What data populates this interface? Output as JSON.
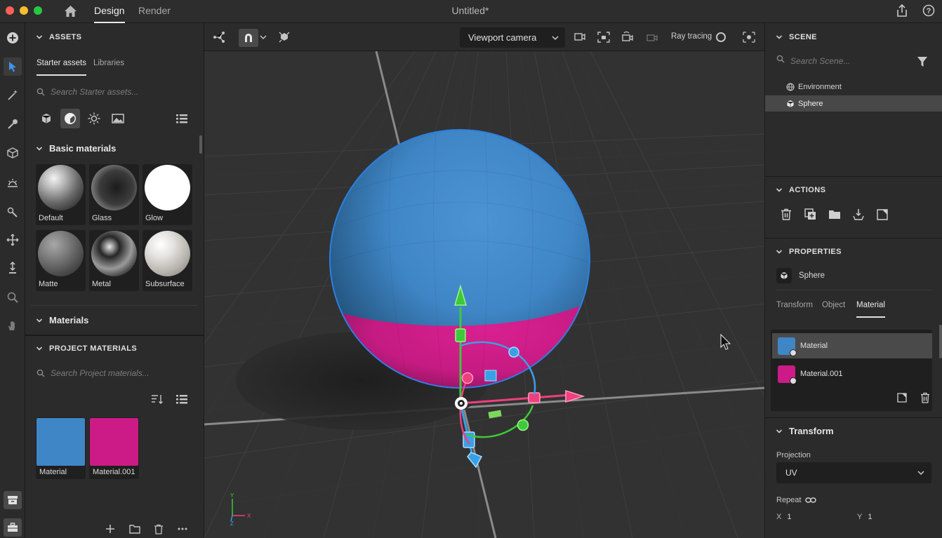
{
  "titlebar": {
    "tabs": [
      "Design",
      "Render"
    ],
    "active_tab": "Design",
    "document_title": "Untitled*"
  },
  "assets": {
    "header": "ASSETS",
    "subtabs": [
      "Starter assets",
      "Libraries"
    ],
    "search_placeholder": "Search Starter assets...",
    "basic_materials_title": "Basic materials",
    "basic_materials": [
      {
        "label": "Default"
      },
      {
        "label": "Glass"
      },
      {
        "label": "Glow"
      },
      {
        "label": "Matte"
      },
      {
        "label": "Metal"
      },
      {
        "label": "Subsurface"
      }
    ],
    "materials_title": "Materials"
  },
  "project_materials": {
    "header": "PROJECT MATERIALS",
    "search_placeholder": "Search Project materials...",
    "items": [
      {
        "label": "Material",
        "color": "#3f86c6"
      },
      {
        "label": "Material.001",
        "color": "#cc1b86"
      }
    ]
  },
  "viewport": {
    "camera_select": "Viewport camera",
    "ray_tracing_label": "Ray tracing",
    "axis_labels": {
      "y": "Y",
      "x": "X",
      "z": "Z"
    }
  },
  "scene": {
    "header": "SCENE",
    "search_placeholder": "Search Scene...",
    "items": [
      {
        "label": "Environment",
        "icon": "globe-icon"
      },
      {
        "label": "Sphere",
        "icon": "cube-icon",
        "selected": true
      }
    ]
  },
  "actions": {
    "header": "ACTIONS"
  },
  "properties": {
    "header": "PROPERTIES",
    "object_name": "Sphere",
    "tabs": [
      "Transform",
      "Object",
      "Material"
    ],
    "active_tab": "Material",
    "materials": [
      {
        "label": "Material",
        "color": "#3f86c6",
        "selected": true
      },
      {
        "label": "Material.001",
        "color": "#cc1b86",
        "selected": false
      }
    ],
    "transform_title": "Transform",
    "projection_label": "Projection",
    "projection_value": "UV",
    "repeat_label": "Repeat",
    "repeat_x_label": "X",
    "repeat_x_value": "1",
    "repeat_y_label": "Y",
    "repeat_y_value": "1"
  },
  "colors": {
    "accent_blue": "#3f86c6",
    "accent_magenta": "#cc1b86",
    "gizmo_green": "#3ec93a",
    "gizmo_pink": "#ee3f7e",
    "gizmo_blue": "#3aa0e6",
    "selection_outline": "#2d7fe0"
  }
}
